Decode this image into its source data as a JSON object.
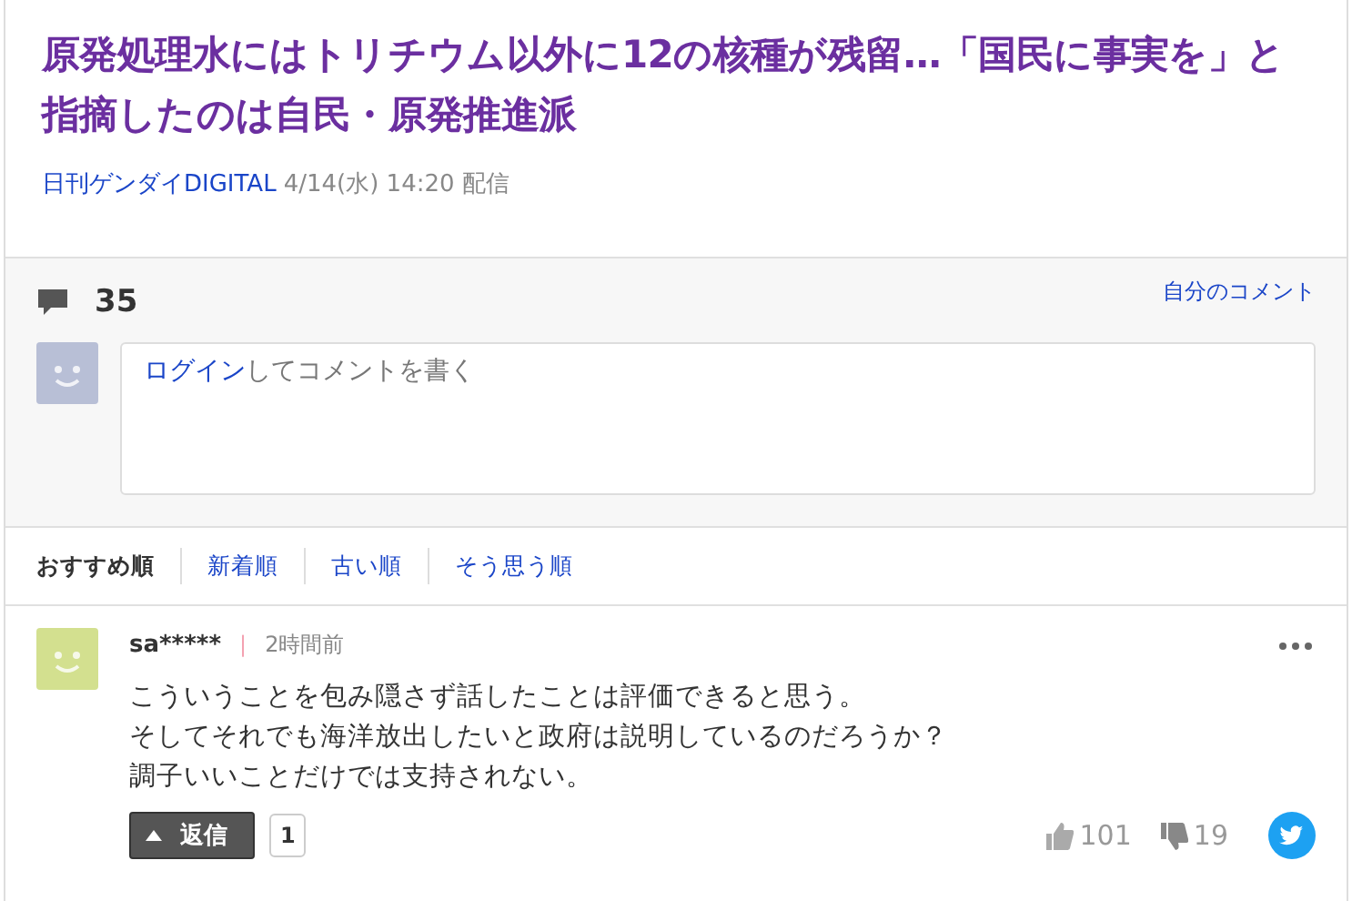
{
  "article": {
    "title": "原発処理水にはトリチウム以外に12の核種が残留…「国民に事実を」と指摘したのは自民・原発推進派",
    "source": "日刊ゲンダイDIGITAL",
    "date": "4/14(水) 14:20 配信"
  },
  "comments_header": {
    "count": "35",
    "my_comments_link": "自分のコメント",
    "login_link": "ログイン",
    "compose_text": "してコメントを書く"
  },
  "sort_tabs": [
    {
      "label": "おすすめ順",
      "selected": true
    },
    {
      "label": "新着順",
      "selected": false
    },
    {
      "label": "古い順",
      "selected": false
    },
    {
      "label": "そう思う順",
      "selected": false
    }
  ],
  "comments": [
    {
      "user": "sa*****",
      "separator": "|",
      "time": "2時間前",
      "lines": [
        "こういうことを包み隠さず話したことは評価できると思う。",
        "そしてそれでも海洋放出したいと政府は説明しているのだろうか？",
        "調子いいことだけでは支持されない。"
      ],
      "reply_label": "返信",
      "reply_count": "1",
      "likes": "101",
      "dislikes": "19"
    }
  ]
}
